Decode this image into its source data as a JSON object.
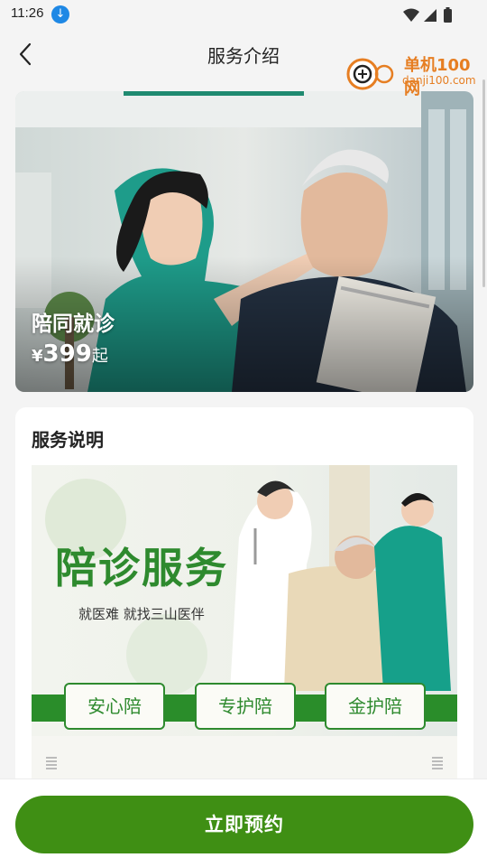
{
  "status_bar": {
    "time": "11:26",
    "download_icon": "download-icon"
  },
  "header": {
    "title": "服务介绍"
  },
  "hero": {
    "service_name": "陪同就诊",
    "currency": "¥",
    "price": "399",
    "price_suffix": "起"
  },
  "service_section": {
    "title": "服务说明",
    "banner": {
      "title": "陪诊服务",
      "subtitle": "就医难 就找三山医伴",
      "options": [
        "安心陪",
        "专护陪",
        "金护陪"
      ]
    }
  },
  "footer": {
    "book_label": "立即预约"
  },
  "watermark": {
    "text": "单机100网",
    "url": "danji100.com"
  },
  "colors": {
    "primary_green": "#3f8f14",
    "banner_green": "#2e8a2e",
    "watermark_orange": "#e67e22"
  }
}
